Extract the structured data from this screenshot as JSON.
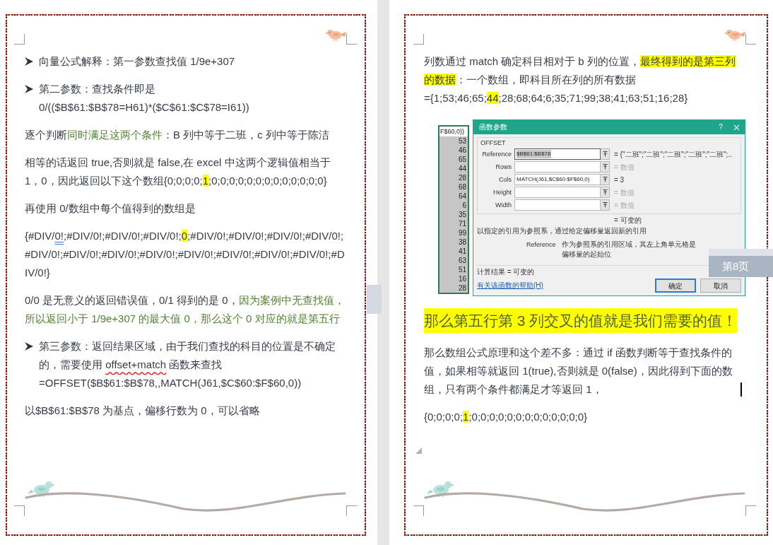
{
  "pages": [
    {
      "end_mark": false,
      "blocks": [
        {
          "kind": "bullet",
          "segments": [
            {
              "kind": "plain",
              "text": "向量公式解释：第一参数查找值 1/9e+307"
            }
          ]
        },
        {
          "kind": "bullet",
          "segments": [
            {
              "kind": "plain",
              "text": "第二参数：查找条件即是 "
            },
            {
              "kind": "formula",
              "text": "0/(($B$61:$B$78=H61)*($C$61:$C$78=I61))"
            }
          ]
        },
        {
          "kind": "paragraph",
          "segments": [
            {
              "kind": "plain",
              "text": "逐个判断"
            },
            {
              "kind": "green",
              "text": "同时满足这两个条件"
            },
            {
              "kind": "plain",
              "text": "：B 列中等于二班，c 列中等于陈洁"
            }
          ]
        },
        {
          "kind": "paragraph",
          "segments": [
            {
              "kind": "plain",
              "text": "相等的话返回 true,否则就是 false,在 excel 中这两个逻辑值相当于 1，0，因此返回以下这个数组{0;0;0;0;"
            },
            {
              "kind": "highlight",
              "text": "1"
            },
            {
              "kind": "plain",
              "text": ";0;0;0;0;0;0;0;0;0;0;0;0;0}"
            }
          ]
        },
        {
          "kind": "paragraph",
          "segments": [
            {
              "kind": "plain",
              "text": "再使用 0/数组中每个值得到的数组是"
            }
          ]
        },
        {
          "kind": "array",
          "segments": [
            {
              "kind": "plain",
              "text": "{#DIV/"
            },
            {
              "kind": "grammar",
              "text": "0!"
            },
            {
              "kind": "plain",
              "text": ";#DIV/0!;#DIV/0!;#DIV/0!;"
            },
            {
              "kind": "highlight",
              "text": "0"
            },
            {
              "kind": "plain",
              "text": ";#DIV/0!;#DIV/0!;#DIV/0!;#DIV/0!;#DIV/0!;#DIV/0!;#DIV/0!;#DIV/0!;#DIV/0!;#DIV/0!;#DIV/0!;#DIV/0!;#DIV/0!}"
            }
          ]
        },
        {
          "kind": "paragraph",
          "segments": [
            {
              "kind": "plain",
              "text": "0/0 是无意义的返回错误值，0/1 得到的是 0，"
            },
            {
              "kind": "green",
              "text": "因为案例中无查找值，所以返回小于 1/9e+307 的最大值 0，那么这个 0 对应的就是第五行"
            }
          ]
        },
        {
          "kind": "bullet",
          "segments": [
            {
              "kind": "plain",
              "text": "第三参数：返回结果区域，由于我们查找的科目的位置是不确定的，需要使用 "
            },
            {
              "kind": "spelling",
              "text": "offset+match"
            },
            {
              "kind": "plain",
              "text": " 函数来查找 "
            },
            {
              "kind": "formula",
              "text": "=OFFSET($B$61:$B$78,,MATCH(J61,$C$60:$F$60,0))"
            }
          ]
        },
        {
          "kind": "paragraph",
          "segments": [
            {
              "kind": "plain",
              "text": "以$B$61:$B$78 为基点，偏移行数为 0，可以省略"
            }
          ]
        }
      ]
    },
    {
      "end_mark": true,
      "blocks": [
        {
          "kind": "paragraph",
          "segments": [
            {
              "kind": "plain",
              "text": "列数通过 match 确定科目相对于 b 列的位置，"
            },
            {
              "kind": "highlight",
              "text": "最终得到的是第三列的数据"
            },
            {
              "kind": "plain",
              "text": "：一个数组，即科目所在列的所有数据 "
            },
            {
              "kind": "formula",
              "text": "={1;53;46;65;"
            },
            {
              "kind": "highlight",
              "text": "44"
            },
            {
              "kind": "formula",
              "text": ";28;68;64;6;35;71;99;38;41;63;51;16;28}"
            }
          ]
        },
        {
          "kind": "screenshot",
          "column": {
            "header": "F$60,0))",
            "values": [
              "53",
              "46",
              "65",
              "44",
              "28",
              "68",
              "64",
              "6",
              "35",
              "71",
              "99",
              "38",
              "41",
              "63",
              "51",
              "16",
              "28"
            ]
          },
          "dialog": {
            "title": "函数参数",
            "help": "?",
            "function_name": "OFFSET",
            "arguments": [
              {
                "label": "Reference",
                "value": "$B$61:$B$78",
                "selected": true,
                "result": "= {\"二班\";\"二班\";\"二班\";\"二班\";\"二班\";..",
                "result_greyed": false
              },
              {
                "label": "Rows",
                "selected": false,
                "result": "= 数值",
                "result_greyed": true
              },
              {
                "label": "Cols",
                "value": "MATCH(J61,$C$60:$F$60,0)",
                "selected": false,
                "result": "= 3",
                "result_greyed": false
              },
              {
                "label": "Height",
                "selected": false,
                "result": "= 数值",
                "result_greyed": true
              },
              {
                "label": "Width",
                "selected": false,
                "result": "= 数值",
                "result_greyed": true
              }
            ],
            "formula_result": "= 可变的",
            "description": "以指定的引用为参照系，通过给定偏移量返回新的引用",
            "argument_name": "Reference",
            "argument_help": "作为参照系的引用区域，其左上角单元格是偏移量的起始位",
            "calculation_result": "计算结果 = 可变的",
            "help_link": "有关该函数的帮助(H)",
            "buttons": [
              {
                "label": "确定",
                "default": true
              },
              {
                "label": "取消",
                "default": false
              }
            ]
          }
        },
        {
          "kind": "heading",
          "segments": [
            {
              "kind": "highlight",
              "text": "那么第五行第 3 列交叉的值就是我们需要的值！"
            }
          ]
        },
        {
          "kind": "paragraph",
          "segments": [
            {
              "kind": "plain",
              "text": "那么数组公式原理和这个差不多：通过 if 函数判断等于查找条件的值，如果相等就返回 1(true),否则就是 0(false)，因此得到下面的数组，只有两个条件都满足才等返回 1，"
            },
            {
              "kind": "cursor"
            }
          ]
        },
        {
          "kind": "paragraph",
          "segments": [
            {
              "kind": "plain",
              "text": "{0;0;0;0;"
            },
            {
              "kind": "highlight",
              "text": "1"
            },
            {
              "kind": "plain",
              "text": ";0;0;0;0;0;0;0;0;0;0;0;0;0}"
            }
          ]
        }
      ]
    }
  ],
  "page_tab": "第8页"
}
